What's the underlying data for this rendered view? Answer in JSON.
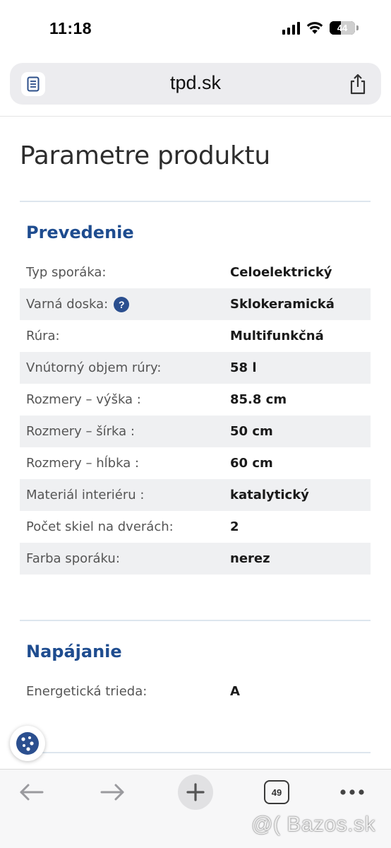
{
  "status_bar": {
    "time": "11:18",
    "battery": "44",
    "battery_level_percent": 44
  },
  "address_bar": {
    "url": "tpd.sk",
    "reader_icon": "reader-mode-icon",
    "share_icon": "share-icon"
  },
  "page": {
    "title": "Parametre produktu"
  },
  "sections": [
    {
      "title": "Prevedenie",
      "rows": [
        {
          "label": "Typ sporáka:",
          "value": "Celoelektrický"
        },
        {
          "label": "Varná doska:",
          "value": "Sklokeramická",
          "help": "?"
        },
        {
          "label": "Rúra:",
          "value": "Multifunkčná"
        },
        {
          "label": "Vnútorný objem rúry:",
          "value": "58 l"
        },
        {
          "label": "Rozmery – výška :",
          "value": "85.8 cm"
        },
        {
          "label": "Rozmery – šírka :",
          "value": "50 cm"
        },
        {
          "label": "Rozmery – hĺbka :",
          "value": "60 cm"
        },
        {
          "label": "Materiál interiéru :",
          "value": "katalytický"
        },
        {
          "label": "Počet skiel na dverách:",
          "value": "2"
        },
        {
          "label": "Farba sporáku:",
          "value": "nerez"
        }
      ]
    },
    {
      "title": "Napájanie",
      "rows": [
        {
          "label": "Energetická trieda:",
          "value": "A"
        }
      ]
    }
  ],
  "toolbar": {
    "tabs_count": "49",
    "icons": [
      "back-arrow-icon",
      "forward-arrow-icon",
      "plus-icon",
      "tabs-icon",
      "more-icon"
    ]
  },
  "watermark": "@( Bazos.sk",
  "colors": {
    "section_title": "#1e4c8f",
    "help_icon": "#2b4f8f",
    "row_shade": "#eff0f2",
    "rule": "#dde6ee"
  }
}
